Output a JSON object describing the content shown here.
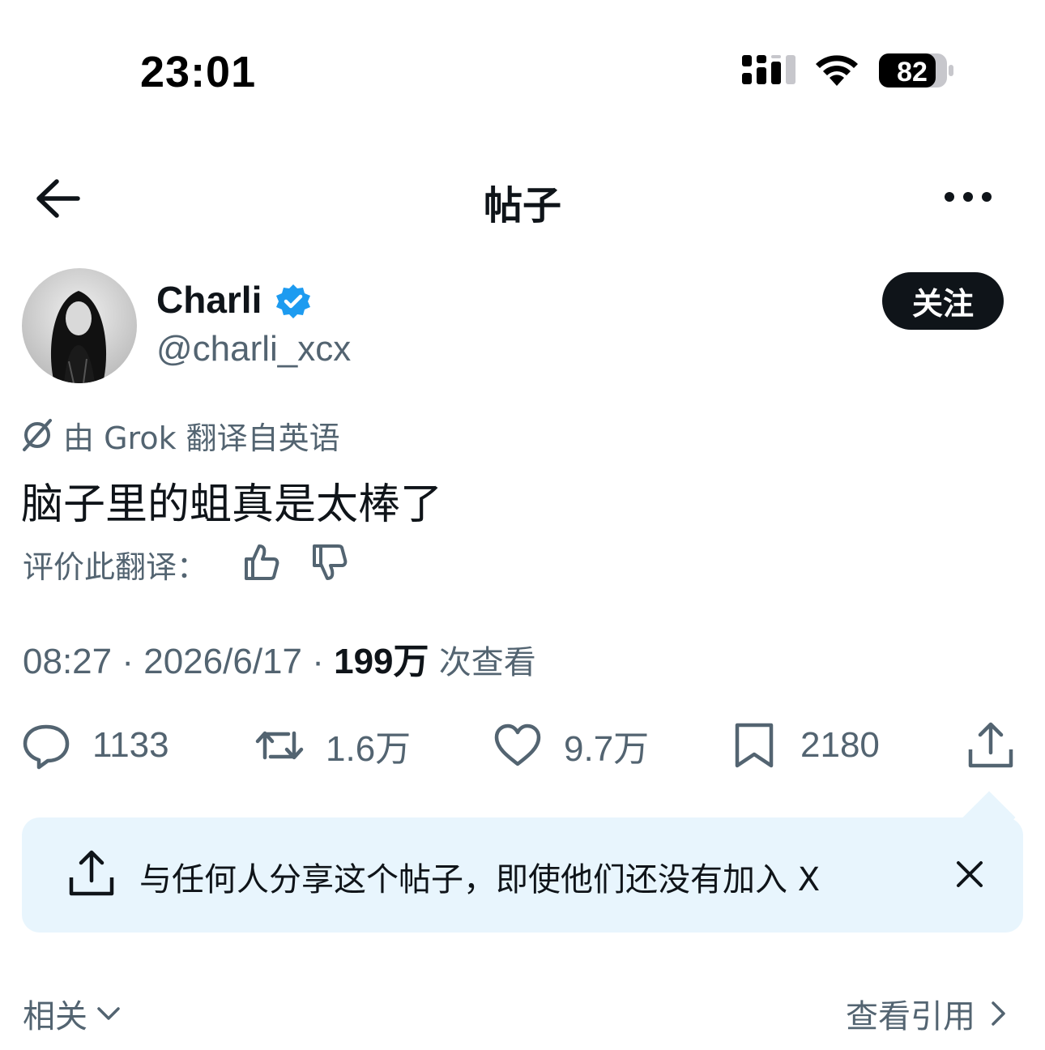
{
  "status_bar": {
    "time": "23:01",
    "battery": "82"
  },
  "nav": {
    "title": "帖子"
  },
  "post": {
    "author_name": "Charli",
    "handle": "@charli_xcx",
    "follow_label": "关注",
    "translation_note": "由 Grok 翻译自英语",
    "text": "脑子里的蛆真是太棒了",
    "rate_translation_label": "评价此翻译：",
    "time": "08:27",
    "date": "2026/6/17",
    "views_count": "199万",
    "views_label": "次查看",
    "separator": "·"
  },
  "actions": {
    "replies": "1133",
    "reposts": "1.6万",
    "likes": "9.7万",
    "bookmarks": "2180"
  },
  "tip": {
    "text": "与任何人分享这个帖子，即使他们还没有加入 X"
  },
  "footer": {
    "related_label": "相关",
    "quotes_label": "查看引用"
  },
  "colors": {
    "primary_text": "#0f1419",
    "secondary_text": "#536471",
    "verified_blue": "#1d9bf0",
    "tip_background": "#e8f5fd"
  }
}
